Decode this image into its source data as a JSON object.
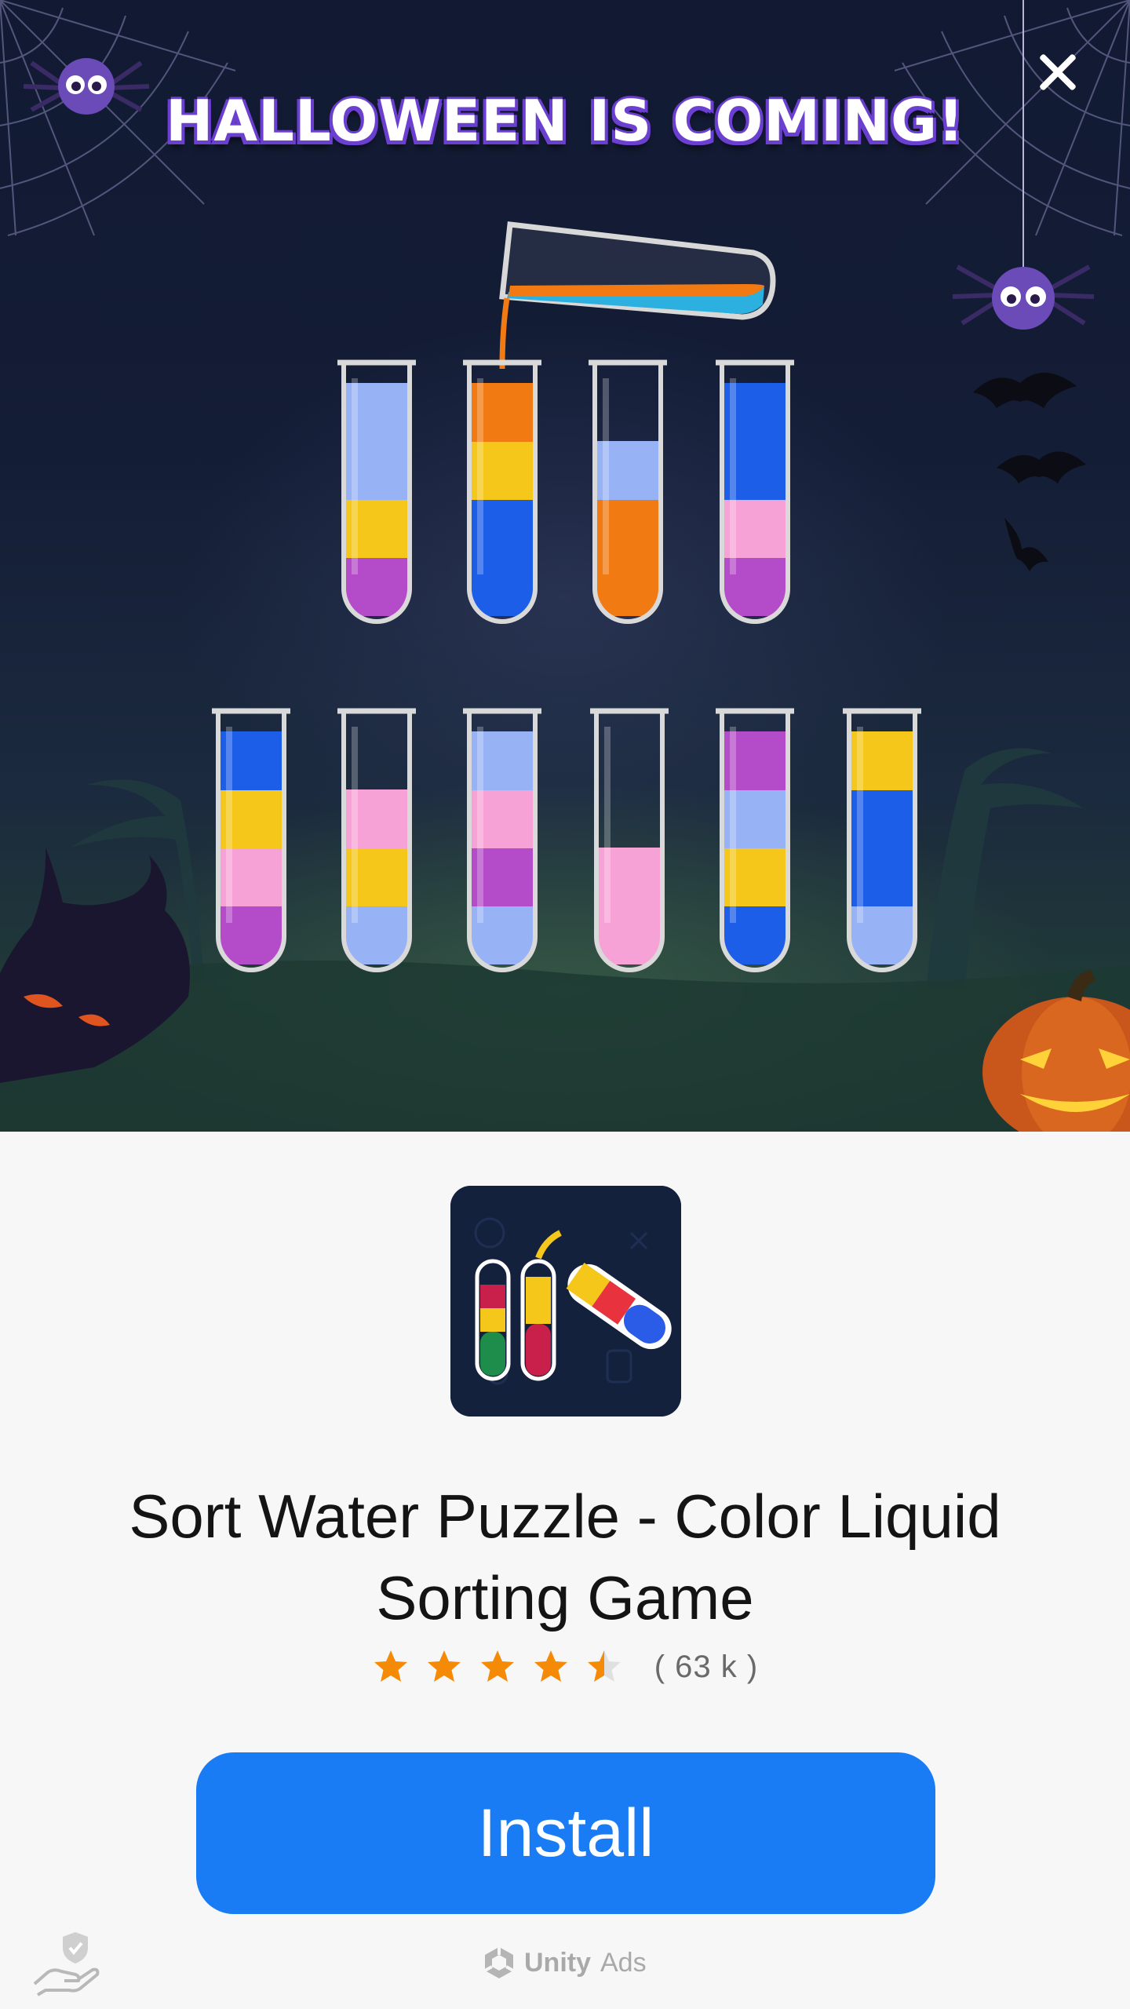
{
  "ad": {
    "headline": "HALLOWEEN IS COMING!",
    "close_label": "×"
  },
  "game_scene": {
    "top_tubes": [
      [
        "#b44cc9",
        "#f5c71a",
        "#98b3f5",
        "#98b3f5"
      ],
      [
        "#1c5ee8",
        "#1c5ee8",
        "#f5c71a",
        "#f27a12"
      ],
      [
        "#f27a12",
        "#f27a12",
        "#98b3f5"
      ],
      [
        "#b44cc9",
        "#f7a2d6",
        "#1c5ee8",
        "#1c5ee8"
      ]
    ],
    "bottom_tubes": [
      [
        "#b44cc9",
        "#f7a2d6",
        "#f5c71a",
        "#1c5ee8"
      ],
      [
        "#98b3f5",
        "#f5c71a",
        "#f7a2d6"
      ],
      [
        "#98b3f5",
        "#b44cc9",
        "#f7a2d6",
        "#98b3f5"
      ],
      [
        "#f7a2d6",
        "#f7a2d6"
      ],
      [
        "#1c5ee8",
        "#f5c71a",
        "#98b3f5",
        "#b44cc9"
      ],
      [
        "#98b3f5",
        "#1c5ee8",
        "#1c5ee8",
        "#f5c71a"
      ]
    ]
  },
  "app": {
    "title": "Sort Water Puzzle - Color Liquid Sorting Game",
    "rating": 4.5,
    "rating_max": 5,
    "rating_count": "( 63 k )",
    "install_label": "Install"
  },
  "footer": {
    "brand": "Unity",
    "brand_suffix": "Ads"
  },
  "colors": {
    "install_button": "#1a7cf5",
    "star_fill": "#f58a07",
    "star_empty": "#e0e0e0",
    "headline_outline": "#6b3fd0"
  }
}
